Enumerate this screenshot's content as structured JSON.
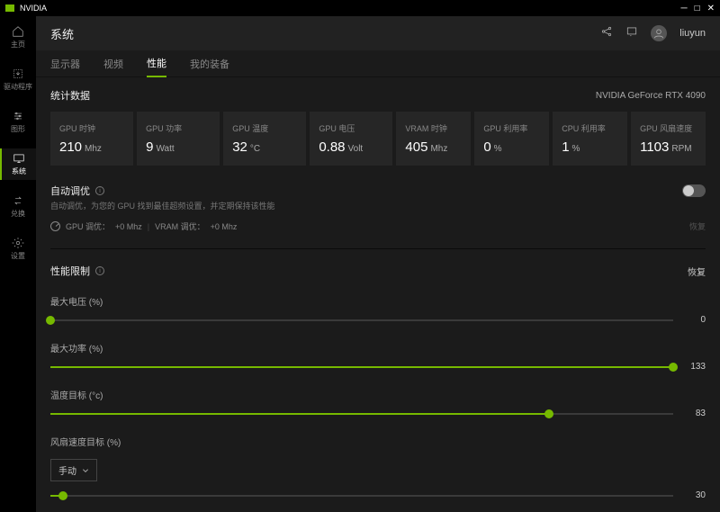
{
  "app_name": "NVIDIA",
  "header": {
    "title": "系统",
    "username": "liuyun"
  },
  "sidebar": {
    "items": [
      {
        "label": "主页"
      },
      {
        "label": "驱动程序"
      },
      {
        "label": "图形"
      },
      {
        "label": "系统"
      },
      {
        "label": "兑换"
      },
      {
        "label": "设置"
      }
    ],
    "active_index": 3
  },
  "tabs": {
    "items": [
      "显示器",
      "视频",
      "性能",
      "我的装备"
    ],
    "active_index": 2
  },
  "statistics": {
    "title": "统计数据",
    "gpu_name": "NVIDIA GeForce RTX 4090",
    "cards": [
      {
        "label": "GPU 时钟",
        "value": "210",
        "unit": "Mhz"
      },
      {
        "label": "GPU 功率",
        "value": "9",
        "unit": "Watt"
      },
      {
        "label": "GPU 温度",
        "value": "32",
        "unit": "°C"
      },
      {
        "label": "GPU 电压",
        "value": "0.88",
        "unit": "Volt"
      },
      {
        "label": "VRAM 时钟",
        "value": "405",
        "unit": "Mhz"
      },
      {
        "label": "GPU 利用率",
        "value": "0",
        "unit": "%"
      },
      {
        "label": "CPU 利用率",
        "value": "1",
        "unit": "%"
      },
      {
        "label": "GPU 风扇速度",
        "value": "1103",
        "unit": "RPM"
      }
    ]
  },
  "auto_tune": {
    "title": "自动调优",
    "description": "自动调优，为您的 GPU 找到最佳超频设置，并定期保持该性能",
    "gpu_tune_label": "GPU 调优：",
    "gpu_tune_value": "+0 Mhz",
    "vram_tune_label": "VRAM 调优：",
    "vram_tune_value": "+0 Mhz",
    "restore": "恢复",
    "enabled": false
  },
  "perf_limits": {
    "title": "性能限制",
    "restore": "恢复",
    "sliders": [
      {
        "label": "最大电压 (%)",
        "value": 0,
        "percent": 0
      },
      {
        "label": "最大功率 (%)",
        "value": 133,
        "percent": 100
      },
      {
        "label": "温度目标 (°c)",
        "value": 83,
        "percent": 80
      }
    ],
    "fan": {
      "label": "风扇速度目标 (%)",
      "mode_label": "手动",
      "value": 30,
      "percent": 2
    }
  }
}
